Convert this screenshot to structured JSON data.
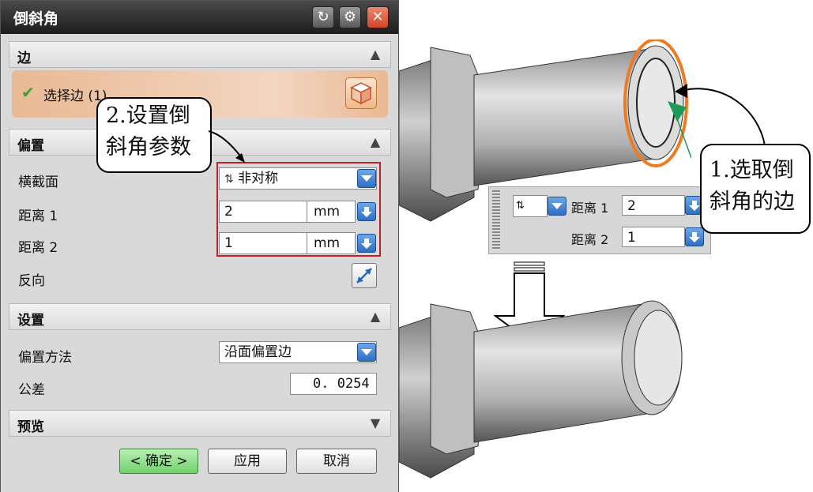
{
  "dialog": {
    "title": "倒斜角",
    "titlebar_icons": [
      "reset-icon",
      "gear-icon",
      "close-icon"
    ],
    "sections": {
      "edge": {
        "label": "边",
        "select_label": "选择边 (1)"
      },
      "offset": {
        "label": "偏置",
        "cross_section_label": "横截面",
        "cross_section_value": "非对称",
        "distance1_label": "距离 1",
        "distance1_value": "2",
        "distance1_unit": "mm",
        "distance2_label": "距离 2",
        "distance2_value": "1",
        "distance2_unit": "mm",
        "reverse_label": "反向"
      },
      "settings": {
        "label": "设置",
        "offset_method_label": "偏置方法",
        "offset_method_value": "沿面偏置边",
        "tolerance_label": "公差",
        "tolerance_value": "0. 0254"
      },
      "preview": {
        "label": "预览"
      }
    },
    "buttons": {
      "ok": "< 确定 >",
      "apply": "应用",
      "cancel": "取消"
    }
  },
  "callouts": {
    "step2_line1": "2.设置倒",
    "step2_line2": "斜角参数",
    "step1_line1": "1.选取倒",
    "step1_line2": "斜角的边"
  },
  "mini_panel": {
    "distance1_label": "距离 1",
    "distance1_value": "2",
    "distance2_label": "距离 2",
    "distance2_value": "1"
  },
  "colors": {
    "accent_select": "#f3d6c2",
    "highlight_box": "#c0202a",
    "edge_highlight": "#f07a22",
    "ok_button": "#72d06d"
  }
}
